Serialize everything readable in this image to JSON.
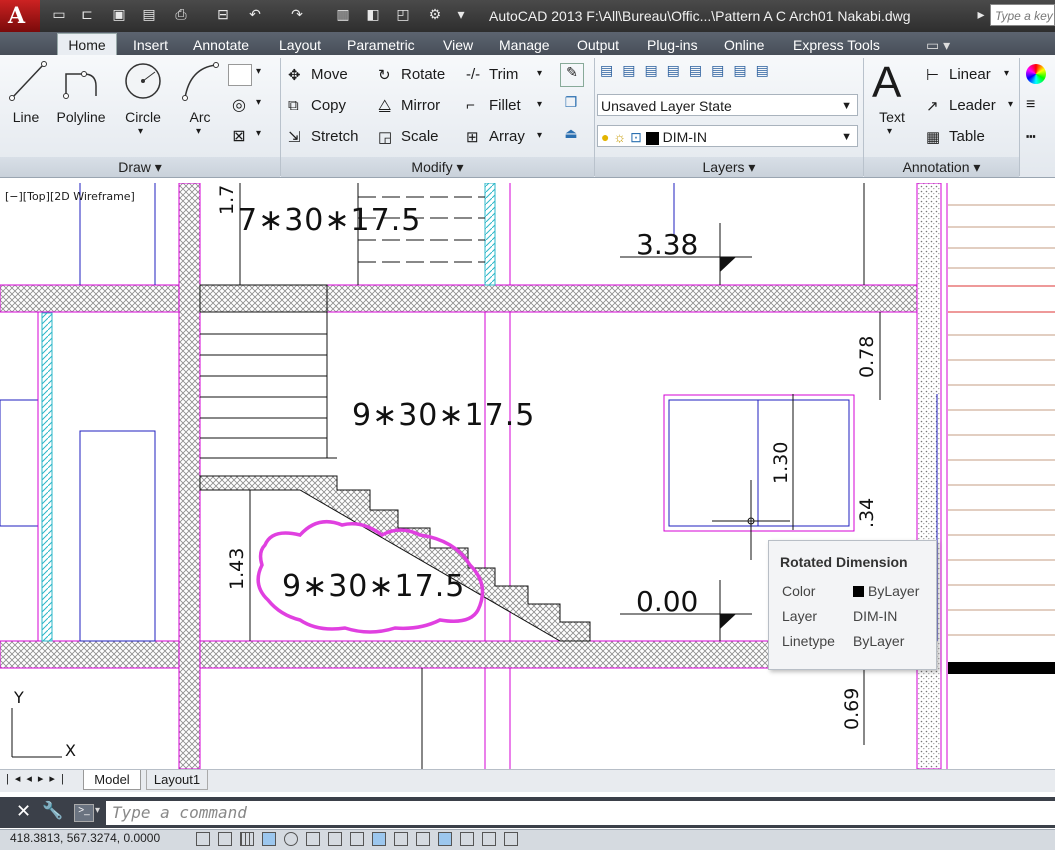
{
  "app": {
    "logo": "A",
    "title": "AutoCAD 2013    F:\\All\\Bureau\\Offic...\\Pattern A  C Arch01 Nakabi.dwg",
    "search_placeholder": "Type a key"
  },
  "tabs": [
    "Home",
    "Insert",
    "Annotate",
    "Layout",
    "Parametric",
    "View",
    "Manage",
    "Output",
    "Plug-ins",
    "Online",
    "Express Tools"
  ],
  "draw": {
    "title": "Draw",
    "tools": [
      "Line",
      "Polyline",
      "Circle",
      "Arc"
    ]
  },
  "modify": {
    "title": "Modify",
    "rows": [
      [
        "Move",
        "Rotate",
        "Trim"
      ],
      [
        "Copy",
        "Mirror",
        "Fillet"
      ],
      [
        "Stretch",
        "Scale",
        "Array"
      ]
    ]
  },
  "layers": {
    "title": "Layers",
    "layer_state": "Unsaved Layer State",
    "current_layer": "DIM-IN"
  },
  "annotation": {
    "title": "Annotation",
    "text_label": "Text",
    "small": [
      "Linear",
      "Leader",
      "Table"
    ]
  },
  "viewport": {
    "label": "[−][Top][2D Wireframe]"
  },
  "drawing": {
    "stair_text_top": "7∗30∗17.5",
    "stair_text_mid": "9∗30∗17.5",
    "stair_text_low": "9∗30∗17.5",
    "dim_17": "1.7",
    "dim_143": "1.43",
    "dim_130": "1.30",
    "dim_078": "0.78",
    "dim_34": ".34",
    "dim_069": "0.69",
    "level_338": "3.38",
    "level_000": "0.00",
    "ucs_y": "Y",
    "ucs_x": "X"
  },
  "tooltip": {
    "title": "Rotated Dimension",
    "rows": [
      {
        "key": "Color",
        "value": "ByLayer"
      },
      {
        "key": "Layer",
        "value": "DIM-IN"
      },
      {
        "key": "Linetype",
        "value": "ByLayer"
      }
    ]
  },
  "layout_tabs": [
    "Model",
    "Layout1"
  ],
  "command": {
    "placeholder": "Type a command"
  },
  "status": {
    "coordinates": "418.3813, 567.3274, 0.0000"
  },
  "colors": {
    "magenta": "#d400d4",
    "cloud": "#e040e0",
    "hatch": "#b5b5b5",
    "cyan": "#2bb7c9"
  }
}
